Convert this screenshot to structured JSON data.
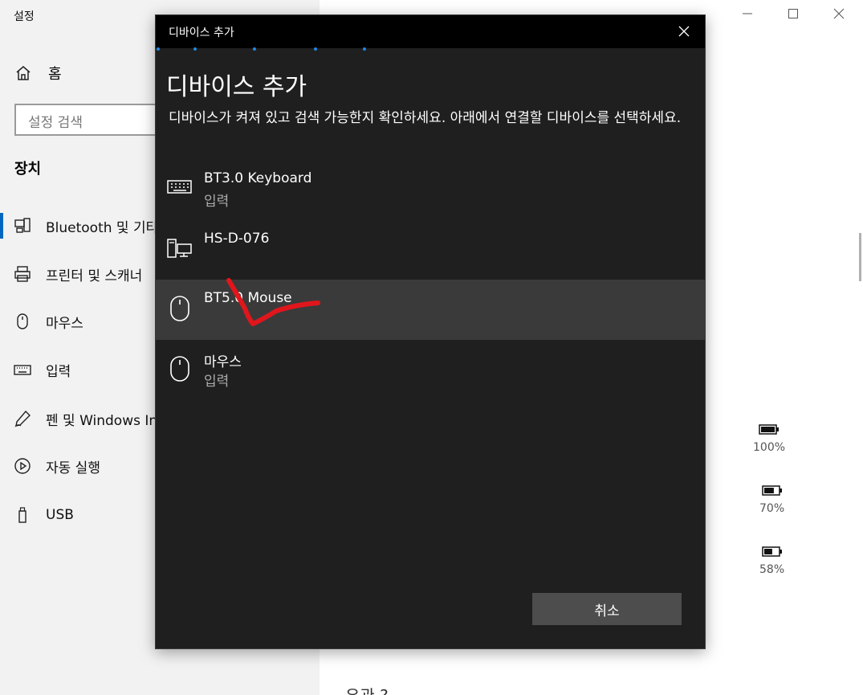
{
  "app": {
    "title": "설정"
  },
  "sidebar": {
    "home_label": "홈",
    "search_placeholder": "설정 검색",
    "section_title": "장치",
    "items": [
      {
        "label": "Bluetooth 및 기타 디바이스",
        "icon": "bluetooth-devices-icon",
        "active": true
      },
      {
        "label": "프린터 및 스캐너",
        "icon": "printer-icon"
      },
      {
        "label": "마우스",
        "icon": "mouse-icon"
      },
      {
        "label": "입력",
        "icon": "keyboard-icon"
      },
      {
        "label": "펜 및 Windows Ink",
        "icon": "pen-icon"
      },
      {
        "label": "자동 실행",
        "icon": "autoplay-icon"
      },
      {
        "label": "USB",
        "icon": "usb-icon"
      }
    ]
  },
  "right_panel": {
    "batteries": [
      {
        "label": "100%",
        "level": 1.0
      },
      {
        "label": "70%",
        "level": 0.7
      },
      {
        "label": "58%",
        "level": 0.58
      }
    ],
    "bottom_text": "유관 ?"
  },
  "dialog": {
    "window_title": "디바이스 추가",
    "heading": "디바이스 추가",
    "description": "디바이스가 켜져 있고 검색 가능한지 확인하세요. 아래에서 연결할 디바이스를 선택하세요.",
    "devices": [
      {
        "name": "BT3.0 Keyboard",
        "type": "입력",
        "icon": "keyboard-icon"
      },
      {
        "name": "HS-D-076",
        "type": "",
        "icon": "computer-icon"
      },
      {
        "name": "BT5.0 Mouse",
        "type": "",
        "icon": "mouse-icon",
        "selected": true
      },
      {
        "name": "마우스",
        "type": "입력",
        "icon": "mouse-icon"
      }
    ],
    "cancel_label": "취소"
  },
  "colors": {
    "accent": "#0067c0",
    "dialog_bg": "#1f1f1f",
    "annotation": "#e0161c"
  }
}
